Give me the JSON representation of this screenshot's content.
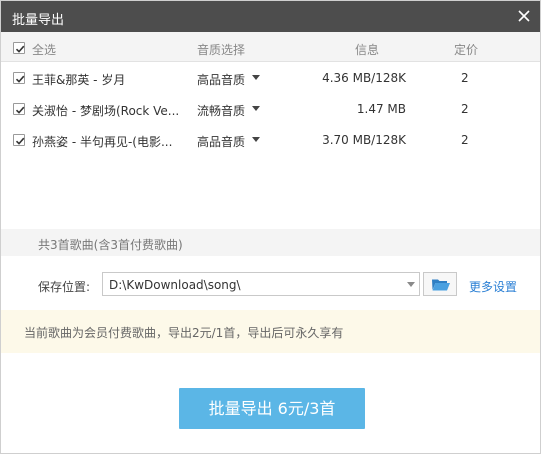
{
  "window": {
    "title": "批量导出"
  },
  "header": {
    "select_all_label": "全选",
    "col_quality": "音质选择",
    "col_info": "信息",
    "col_price": "定价"
  },
  "songs": [
    {
      "name": "王菲&那英 - 岁月",
      "quality": "高品音质",
      "info": "4.36 MB/128K",
      "price": "2",
      "checked": true
    },
    {
      "name": "关淑怡 - 梦剧场(Rock Ve...",
      "quality": "流畅音质",
      "info": "1.47 MB",
      "price": "2",
      "checked": true
    },
    {
      "name": "孙燕姿 - 半句再见-(电影...",
      "quality": "高品音质",
      "info": "3.70 MB/128K",
      "price": "2",
      "checked": true
    }
  ],
  "summary": {
    "text": "共3首歌曲(含3首付费歌曲)"
  },
  "save": {
    "label": "保存位置:",
    "path": "D:\\KwDownload\\song\\",
    "more_settings": "更多设置"
  },
  "notice": {
    "text": "当前歌曲为会员付费歌曲，导出2元/1首，导出后可永久享有"
  },
  "export_button": {
    "label": "批量导出 6元/3首"
  },
  "colors": {
    "titlebar": "#4d4d4d",
    "accent": "#5bb6e6",
    "link": "#2a7fd4",
    "notice_bg": "#fdf9e9"
  }
}
